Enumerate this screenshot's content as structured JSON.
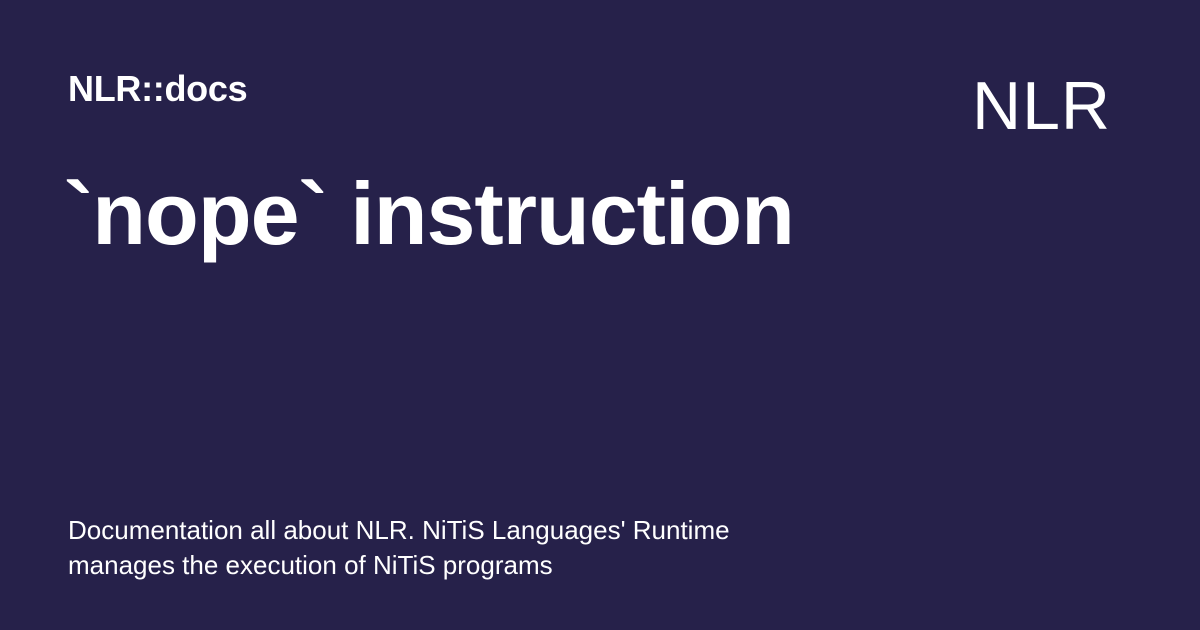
{
  "colors": {
    "background": "#26214a",
    "text": "#ffffff"
  },
  "header": {
    "site_name": "NLR::docs",
    "logo_text": "NLR"
  },
  "main": {
    "title": "`nope` instruction",
    "description_lines": [
      "Documentation all about NLR. NiTiS Languages' Runtime",
      "manages the execution of NiTiS programs"
    ]
  }
}
